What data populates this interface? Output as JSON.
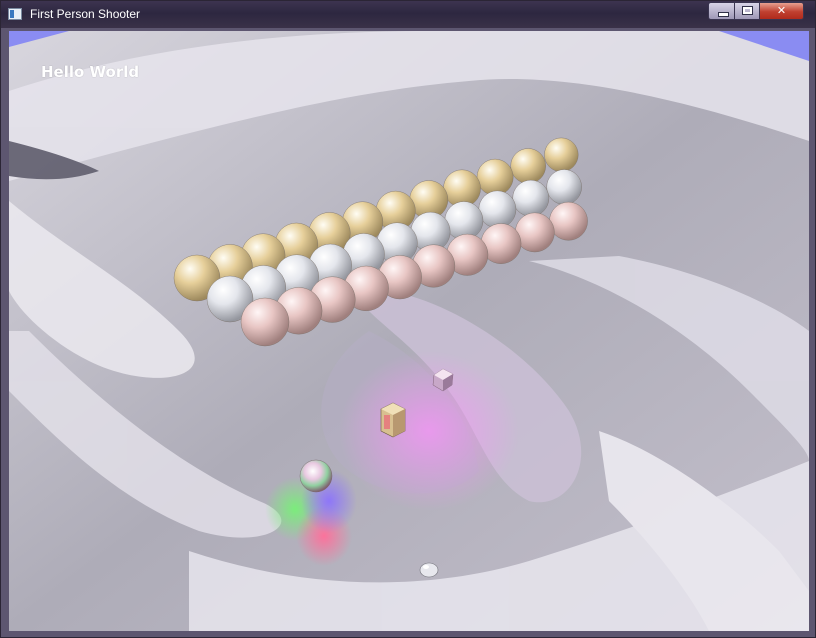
{
  "window": {
    "title": "First Person Shooter",
    "icon": "app-window-icon",
    "controls": [
      "minimize",
      "maximize",
      "close"
    ],
    "close_glyph": "✕"
  },
  "hud": {
    "text": "Hello World"
  },
  "scene": {
    "sky_color": "#8a8cf2",
    "water_color": "#b4b2bc",
    "sphere_grid": {
      "rows": 3,
      "columns": 12,
      "row_colors": [
        "#e6cf9a",
        "#e4e6ec",
        "#e8c6c4"
      ]
    },
    "objects": [
      "crate",
      "small-crystal-cube",
      "glass-sphere",
      "small-rock"
    ],
    "light_colors": [
      "#78f078",
      "#ff6f9a",
      "#8a70ff",
      "#ff90ff"
    ]
  }
}
